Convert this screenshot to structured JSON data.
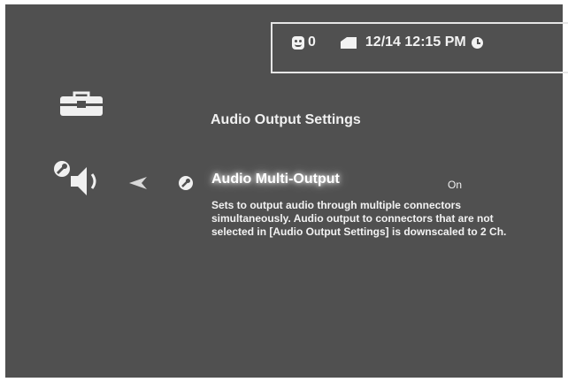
{
  "status_bar": {
    "message_count": "0",
    "datetime": "12/14 12:15 PM"
  },
  "icons": {
    "category": "toolbox-icon",
    "sub_category": "speaker-settings-icon",
    "back": "arrow-left-icon",
    "item_bullet": "wrench-icon",
    "messages": "face-icon",
    "mail": "mail-icon",
    "clock": "clock-icon"
  },
  "page": {
    "section_title": "Audio Output Settings"
  },
  "setting_item": {
    "title": "Audio Multi-Output",
    "value": "On",
    "description": "Sets to output audio through multiple connectors simultaneously. Audio output to connectors that are not selected in [Audio Output Settings] is downscaled to 2 Ch."
  },
  "colors": {
    "background": "#505050",
    "text": "#f2f2f2"
  }
}
